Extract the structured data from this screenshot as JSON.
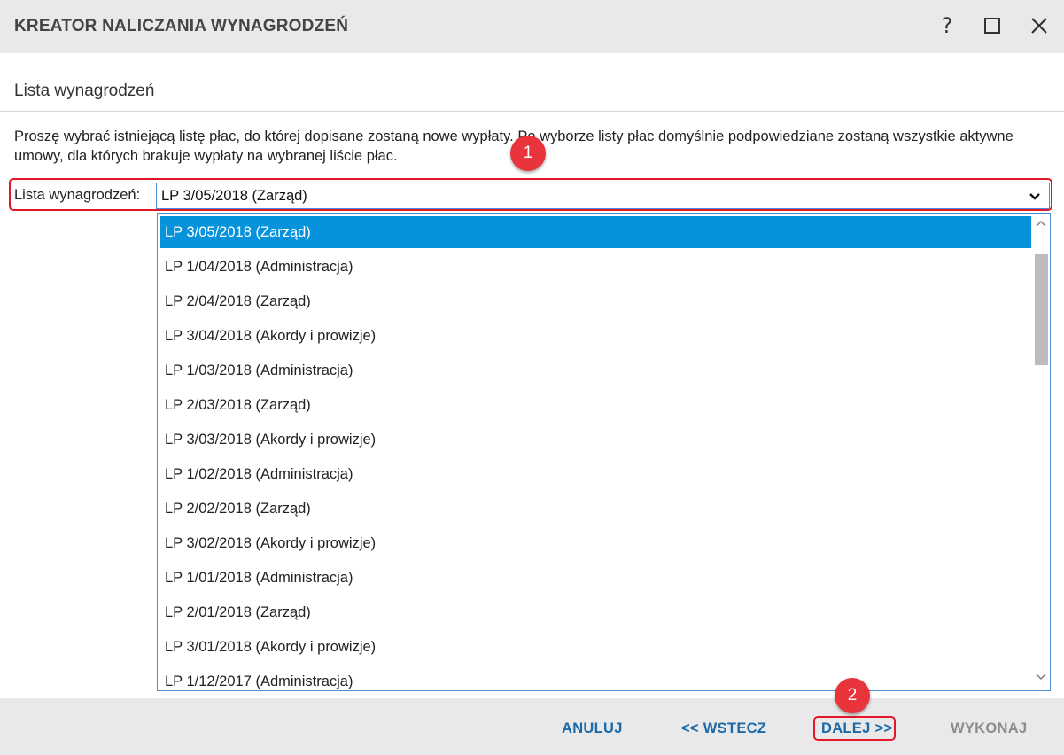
{
  "window": {
    "title": "KREATOR NALICZANIA WYNAGRODZEŃ",
    "help_label": "?"
  },
  "section": {
    "title": "Lista wynagrodzeń",
    "description": "Proszę wybrać istniejącą listę płac, do której dopisane zostaną nowe wypłaty. Po wyborze listy płac domyślnie podpowiedziane zostaną wszystkie aktywne umowy, dla których brakuje wypłaty na wybranej liście płac."
  },
  "field": {
    "label": "Lista wynagrodzeń:",
    "selected_value": "LP 3/05/2018 (Zarząd)"
  },
  "dropdown": {
    "items": [
      "LP 3/05/2018 (Zarząd)",
      "LP 1/04/2018 (Administracja)",
      "LP 2/04/2018 (Zarząd)",
      "LP 3/04/2018 (Akordy i prowizje)",
      "LP 1/03/2018 (Administracja)",
      "LP 2/03/2018 (Zarząd)",
      "LP 3/03/2018 (Akordy i prowizje)",
      "LP 1/02/2018 (Administracja)",
      "LP 2/02/2018 (Zarząd)",
      "LP 3/02/2018 (Akordy i prowizje)",
      "LP 1/01/2018 (Administracja)",
      "LP 2/01/2018 (Zarząd)",
      "LP 3/01/2018 (Akordy i prowizje)",
      "LP 1/12/2017 (Administracja)"
    ],
    "selected_index": 0
  },
  "footer": {
    "cancel_label": "ANULUJ",
    "back_label": "<< WSTECZ",
    "next_label": "DALEJ >>",
    "execute_label": "WYKONAJ"
  },
  "markers": {
    "one": "1",
    "two": "2"
  },
  "colors": {
    "accent": "#1c6aa8",
    "selection": "#0793dc",
    "highlight": "#e0182a",
    "marker": "#e8343a"
  }
}
